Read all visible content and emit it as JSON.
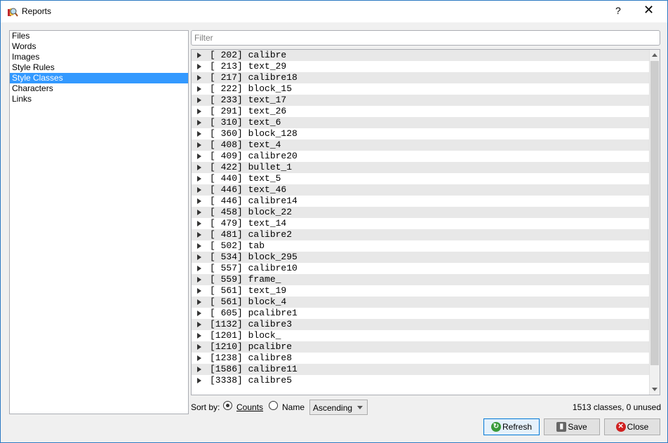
{
  "window": {
    "title": "Reports",
    "help": "?",
    "close": "✕"
  },
  "sidebar": {
    "items": [
      "Files",
      "Words",
      "Images",
      "Style Rules",
      "Style Classes",
      "Characters",
      "Links"
    ],
    "selected": "Style Classes"
  },
  "filter": {
    "placeholder": "Filter",
    "value": ""
  },
  "rows": [
    "[ 202] calibre",
    "[ 213] text_29",
    "[ 217] calibre18",
    "[ 222] block_15",
    "[ 233] text_17",
    "[ 291] text_26",
    "[ 310] text_6",
    "[ 360] block_128",
    "[ 408] text_4",
    "[ 409] calibre20",
    "[ 422] bullet_1",
    "[ 440] text_5",
    "[ 446] text_46",
    "[ 446] calibre14",
    "[ 458] block_22",
    "[ 479] text_14",
    "[ 481] calibre2",
    "[ 502] tab",
    "[ 534] block_295",
    "[ 557] calibre10",
    "[ 559] frame_",
    "[ 561] text_19",
    "[ 561] block_4",
    "[ 605] pcalibre1",
    "[1132] calibre3",
    "[1201] block_",
    "[1210] pcalibre",
    "[1238] calibre8",
    "[1586] calibre11",
    "[3338] calibre5"
  ],
  "sort": {
    "label": "Sort by:",
    "counts": "Counts",
    "name": "Name",
    "selected": "Counts",
    "order": "Ascending"
  },
  "status": "1513 classes, 0 unused",
  "buttons": {
    "refresh": "Refresh",
    "save": "Save",
    "close": "Close"
  }
}
